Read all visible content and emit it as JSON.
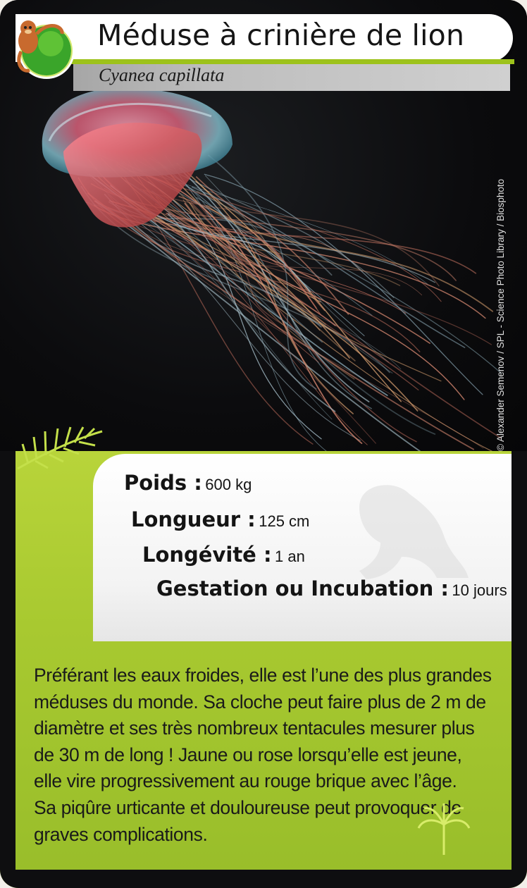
{
  "card": {
    "title": "Méduse à crinière de lion",
    "subtitle": "Cyanea capillata",
    "photo_credit": "© Alexander Semenov / SPL - Science Photo Library / Biosphoto",
    "logo_icon": "monkey-globe-icon",
    "accent_color": "#9dc21b"
  },
  "stats": {
    "poids": {
      "label": "Poids :",
      "value": "600 kg"
    },
    "longueur": {
      "label": "Longueur :",
      "value": "125 cm"
    },
    "longevite": {
      "label": "Longévité :",
      "value": "1 an"
    },
    "gestation": {
      "label": "Gestation ou Incubation :",
      "value": "10 jours"
    }
  },
  "description": {
    "lines": [
      "Préférant les eaux froides, elle est l’une des plus grandes",
      "méduses du monde. Sa cloche peut faire plus de 2 m de",
      "diamètre et ses très nombreux tentacules mesurer plus",
      "de 30 m de long ! Jaune ou rose lorsqu’elle est jeune,",
      "elle vire progressivement au rouge brique avec l’âge.",
      "Sa piqûre urticante et douloureuse peut provoquer de",
      "graves complications."
    ]
  }
}
